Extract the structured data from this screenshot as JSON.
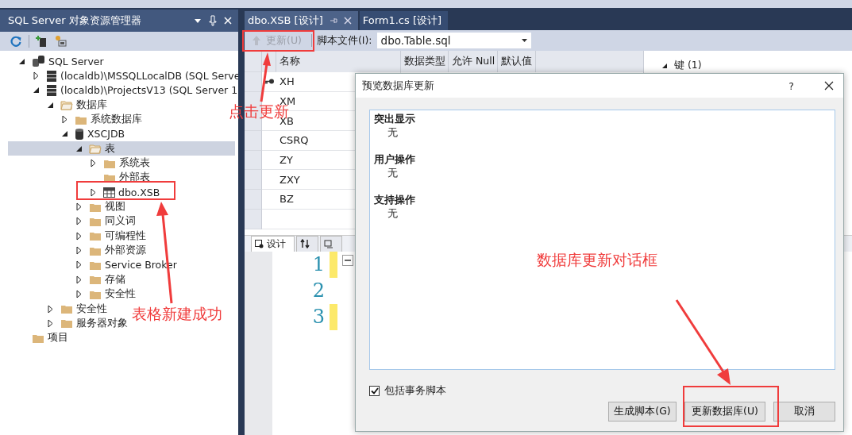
{
  "explorer": {
    "title": "SQL Server 对象资源管理器",
    "tree": [
      {
        "label": "SQL Server",
        "kind": "server-group",
        "expanded": true,
        "selected": false,
        "children": [
          {
            "label": "(localdb)\\MSSQLLocalDB (SQL Serve",
            "kind": "server",
            "expanded": false,
            "selected": false
          },
          {
            "label": "(localdb)\\ProjectsV13 (SQL Server 1",
            "kind": "server",
            "expanded": true,
            "selected": false,
            "children": [
              {
                "label": "数据库",
                "kind": "folder-open",
                "expanded": true,
                "selected": false,
                "children": [
                  {
                    "label": "系统数据库",
                    "kind": "folder",
                    "expanded": false,
                    "selected": false
                  },
                  {
                    "label": "XSCJDB",
                    "kind": "database",
                    "expanded": true,
                    "selected": false,
                    "children": [
                      {
                        "label": "表",
                        "kind": "folder-open",
                        "expanded": true,
                        "selected": true,
                        "children": [
                          {
                            "label": "系统表",
                            "kind": "folder",
                            "expanded": false,
                            "selected": false
                          },
                          {
                            "label": "外部表",
                            "kind": "folder",
                            "selected": false
                          },
                          {
                            "label": "dbo.XSB",
                            "kind": "table",
                            "expanded": false,
                            "selected": false
                          }
                        ]
                      },
                      {
                        "label": "视图",
                        "kind": "folder",
                        "expanded": false,
                        "selected": false
                      },
                      {
                        "label": "同义词",
                        "kind": "folder",
                        "expanded": false,
                        "selected": false
                      },
                      {
                        "label": "可编程性",
                        "kind": "folder",
                        "expanded": false,
                        "selected": false
                      },
                      {
                        "label": "外部资源",
                        "kind": "folder",
                        "expanded": false,
                        "selected": false
                      },
                      {
                        "label": "Service Broker",
                        "kind": "folder",
                        "expanded": false,
                        "selected": false
                      },
                      {
                        "label": "存储",
                        "kind": "folder",
                        "expanded": false,
                        "selected": false
                      },
                      {
                        "label": "安全性",
                        "kind": "folder",
                        "expanded": false,
                        "selected": false
                      }
                    ]
                  }
                ]
              },
              {
                "label": "安全性",
                "kind": "folder",
                "expanded": false,
                "selected": false
              },
              {
                "label": "服务器对象",
                "kind": "folder",
                "expanded": false,
                "selected": false
              }
            ]
          }
        ]
      },
      {
        "label": "项目",
        "kind": "folder",
        "selected": false
      }
    ]
  },
  "document_tabs": [
    {
      "label": "dbo.XSB [设计]",
      "selected": true
    },
    {
      "label": "Form1.cs [设计]",
      "selected": false
    }
  ],
  "designer": {
    "update_button": {
      "label": "更新(U)",
      "disabled": true
    },
    "script_file_label": "脚本文件(I):",
    "script_file": "dbo.Table.sql",
    "columns": [
      "名称",
      "数据类型",
      "允许 Null",
      "默认值"
    ],
    "rows": [
      {
        "name": "XH",
        "primary_key": true
      },
      {
        "name": "XM",
        "primary_key": false
      },
      {
        "name": "XB",
        "primary_key": false
      },
      {
        "name": "CSRQ",
        "primary_key": false
      },
      {
        "name": "ZY",
        "primary_key": false
      },
      {
        "name": "ZXY",
        "primary_key": false
      },
      {
        "name": "BZ",
        "primary_key": false
      }
    ],
    "keys_header": "键 (1)",
    "bottom_tabs": [
      {
        "kind": "design",
        "label": "设计",
        "selected": true
      },
      {
        "kind": "swap",
        "selected": false
      },
      {
        "kind": "tsql",
        "selected": false
      }
    ],
    "code_lines": [
      {
        "number": "1",
        "changed": true
      },
      {
        "number": "2",
        "changed": false
      },
      {
        "number": "3",
        "changed": true
      }
    ]
  },
  "dialog": {
    "title": "预览数据库更新",
    "help": "?",
    "sections": [
      {
        "heading": "突出显示",
        "value": "无"
      },
      {
        "heading": "用户操作",
        "value": "无"
      },
      {
        "heading": "支持操作",
        "value": "无"
      }
    ],
    "include_transaction": {
      "label": "包括事务脚本",
      "checked": true
    },
    "buttons": [
      "生成脚本(G)",
      "更新数据库(U)",
      "取消"
    ]
  },
  "annotations": [
    "点击更新",
    "表格新建成功",
    "数据库更新对话框"
  ]
}
